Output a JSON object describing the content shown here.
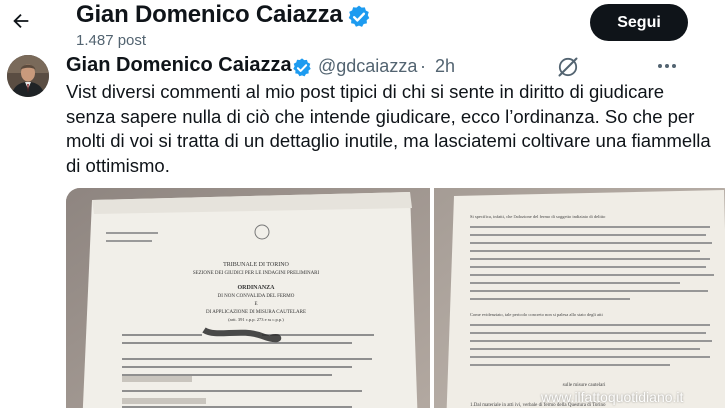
{
  "header": {
    "name": "Gian Domenico Caiazza",
    "post_count": "1.487 post",
    "follow_label": "Segui"
  },
  "post": {
    "author_name": "Gian Domenico Caiazza",
    "handle": "@gdcaiazza",
    "separator": "·",
    "time": "2h",
    "text": "Vist diversi commenti al mio post tipici di chi si sente in diritto di giudicare senza sapere nulla di ciò che intende giudicare, ecco l’ordinanza. So che per molti di voi si tratta di un dettaglio inutile, ma lasciatemi coltivare una fiammella di ottimismo."
  },
  "document_left": {
    "lines": [
      "TRIBUNALE DI TORINO",
      "SEZIONE DEI GIUDICI PER LE INDAGINI PRELIMINARI",
      "ORDINANZA",
      "DI NON CONVALIDA DEL FERMO",
      "E",
      "DI APPLICAZIONE DI MISURA CAUTELARE",
      "(artt. 391 c.p.p. 273 e ss c.p.p.)"
    ]
  },
  "document_right": {
    "lines": [
      "Si specifica, infatti, che l'adozione del fermo di soggetto indiziato di delitto",
      "Come evidenziato, tale pericolo concreto non si palesa allo stato degli atti",
      "sulle misure cautelari",
      "1.Dal materiale in atti ivi, verbale di fermo della Questura di Torino"
    ]
  },
  "watermark": "www.ilfattoquotidiano.it",
  "colors": {
    "text": "#0f1419",
    "secondary": "#536471",
    "verified": "#1d9bf0",
    "follow_bg": "#0f1419"
  },
  "icons": [
    "back-arrow-icon",
    "verified-badge-icon",
    "grok-icon",
    "more-icon"
  ]
}
